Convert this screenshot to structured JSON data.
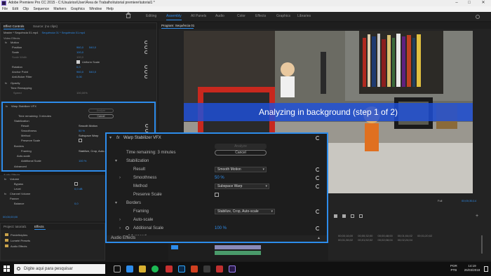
{
  "window": {
    "title": "Adobe Premiere Pro CC 2015 - C:\\Usuários\\User\\Área de Trabalho\\tutorial premiere\\tutorial1 *",
    "controls": [
      "–",
      "□",
      "✕"
    ]
  },
  "menu": [
    "File",
    "Edit",
    "Clip",
    "Sequence",
    "Markers",
    "Graphics",
    "Window",
    "Help"
  ],
  "workspaces": [
    "Editing",
    "Assembly",
    "All Panels",
    "Audio",
    "Color",
    "Effects",
    "Graphics",
    "Libraries"
  ],
  "workspaces_active_index": 1,
  "left_panel": {
    "tabs": [
      "Effect Controls",
      "Source: (no clips)"
    ],
    "clip_header": "Master * Sequência 01.mp4",
    "clip_header_active": "Sequência 01 * Sequência 01.mp4",
    "section_video": "Video Effects",
    "motion": {
      "label": "Motion",
      "position_label": "Position",
      "position_x": "960,0",
      "position_y": "540,0",
      "scale_label": "Scale",
      "scale_value": "100,0",
      "scale_width_label": "Scale Width",
      "scale_width_value": "100,0",
      "uniform_label": "Uniform Scale",
      "rotation_label": "Rotation",
      "rotation_value": "0,0",
      "anchor_label": "Anchor Point",
      "anchor_x": "960,0",
      "anchor_y": "540,0",
      "antiflicker_label": "Anti-flicker Filter",
      "antiflicker_value": "0,00"
    },
    "opacity_label": "Opacity",
    "time_remap_label": "Time Remapping",
    "speed_label": "Speed",
    "speed_value": "100,00%",
    "warp": {
      "label": "Warp Stabilizer VFX",
      "analyze": "Analyze",
      "time_remaining": "Time remaining: 3 minutes",
      "cancel": "Cancel",
      "stabilization": "Stabilization",
      "result_label": "Result",
      "result_value": "Smooth Motion",
      "smoothness_label": "Smoothness",
      "smoothness_value": "50 %",
      "method_label": "Method",
      "method_value": "Subspace Warp",
      "preserve_label": "Preserve Scale",
      "borders": "Borders",
      "framing_label": "Framing",
      "framing_value": "Stabilize, Crop, Auto-sca",
      "autoscale_label": "Auto-scale",
      "additional_label": "Additional Scale",
      "additional_value": "100 %",
      "advanced_label": "Advanced"
    },
    "section_audio": "Audio Effects",
    "volume": {
      "label": "Volume",
      "bypass_label": "Bypass",
      "level_label": "Level",
      "level_value": "0,0 dB"
    },
    "channel_volume_label": "Channel Volume",
    "panner": {
      "label": "Panner",
      "balance_label": "Balance",
      "balance_value": "0,0"
    },
    "timecode": "00;00;00;00"
  },
  "project_panel": {
    "tabs": [
      "Project: tutorial1",
      "Effects"
    ],
    "items": [
      "Predefinições",
      "Lumetri Presets",
      "Audio Effects"
    ]
  },
  "program_monitor": {
    "tab": "Program: Sequência 01",
    "banner": "Analyzing in background (step 1 of 2)",
    "fit_label": "Full",
    "timecode_right": "00;00;36;14"
  },
  "popup": {
    "title": "Warp Stabilizer VFX",
    "fx_label": "fx",
    "analyze": "Analyze",
    "time_remaining": "Time remaining: 3 minutes",
    "cancel": "Cancel",
    "stabilization": "Stabilization",
    "result_label": "Result",
    "result_value": "Smooth Motion",
    "smoothness_label": "Smoothness",
    "smoothness_value": "50 %",
    "method_label": "Method",
    "method_value": "Subspace Warp",
    "preserve_label": "Preserve Scale",
    "borders": "Borders",
    "framing_label": "Framing",
    "framing_value": "Stabilize, Crop, Auto-scale",
    "autoscale_label": "Auto-scale",
    "additional_label": "Additional Scale",
    "additional_value": "100 %",
    "advanced_label": "Advanced",
    "footer_label": "Audio Effects"
  },
  "timeline": {
    "ruler": [
      "00;00;16;00",
      "00;00;32;00",
      "00;00;48;00",
      "00;01;04;02",
      "00;01;20;02",
      "00;01;36;02",
      "00;01;52;02",
      "00;02;08;04",
      "00;02;24;04"
    ]
  },
  "taskbar": {
    "search_placeholder": "Digite aqui para pesquisar",
    "lang": "POR",
    "layout": "PTB",
    "time": "14:19",
    "date": "25/03/2018"
  }
}
